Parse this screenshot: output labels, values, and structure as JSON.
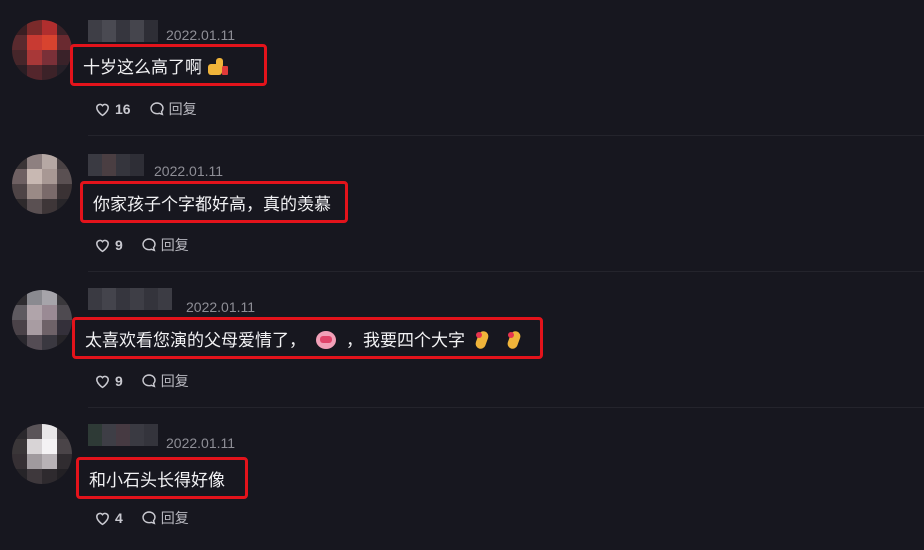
{
  "comments": [
    {
      "date": "2022.01.11",
      "text": "十岁这么高了啊",
      "likes": "16",
      "reply_label": "回复"
    },
    {
      "date": "2022.01.11",
      "text": "你家孩子个字都好高，真的羡慕",
      "likes": "9",
      "reply_label": "回复"
    },
    {
      "date": "2022.01.11",
      "text_before": "太喜欢看您演的父母爱情了，",
      "text_after": "，我要四个大字",
      "likes": "9",
      "reply_label": "回复"
    },
    {
      "date": "2022.01.11",
      "text": "和小石头长得好像",
      "likes": "4",
      "reply_label": "回复"
    }
  ],
  "colors": {
    "background": "#17171f",
    "highlight_border": "#e3131b",
    "muted_text": "#8e8e96"
  },
  "icons": {
    "like": "heart-outline-icon",
    "reply": "speech-bubble-icon"
  }
}
